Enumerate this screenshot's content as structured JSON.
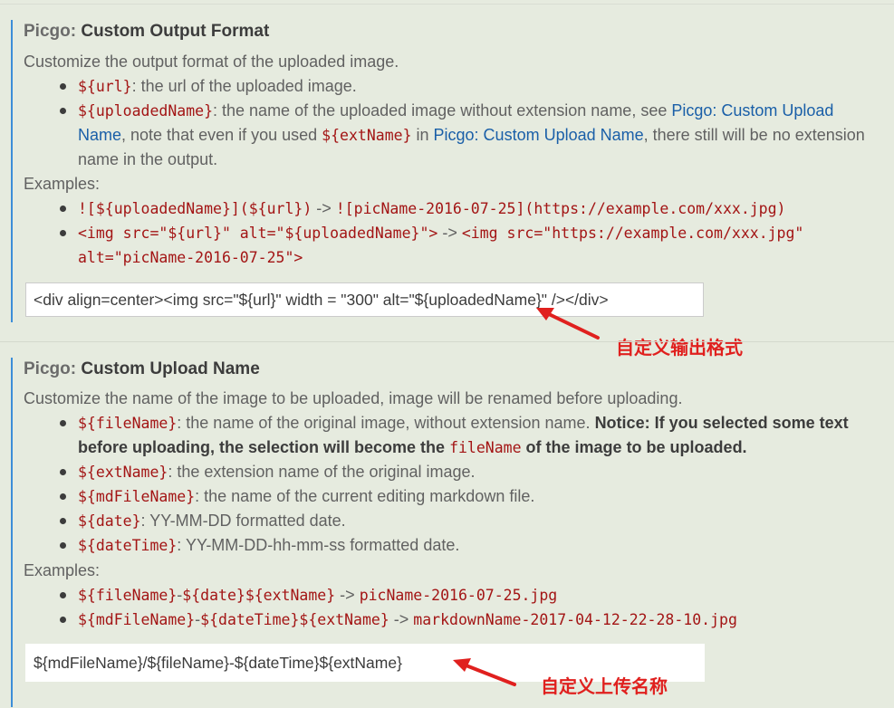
{
  "colors": {
    "accent": "#3d8ed8",
    "code": "#a31515",
    "link": "#1a5fa8",
    "annotation": "#e0201e",
    "background": "#e6ebdf"
  },
  "output_format": {
    "category": "Picgo: ",
    "title": "Custom Output Format",
    "description": "Customize the output format of the uploaded image.",
    "bullets": [
      {
        "code": "${url}",
        "text": ": the url of the uploaded image."
      },
      {
        "code": "${uploadedName}",
        "text1": ": the name of the uploaded image without extension name, see ",
        "link1": "Picgo: Custom Upload Name",
        "text2": ", note that even if you used ",
        "code2": "${extName}",
        "text3": " in ",
        "link2": "Picgo: Custom Upload Name",
        "text4": ", there still will be no extension name in the output."
      }
    ],
    "examples_label": "Examples:",
    "examples": [
      {
        "code": "![${uploadedName}](${url})",
        "arrow": " -> ",
        "result": "![picName-2016-07-25](https://example.com/xxx.jpg)"
      },
      {
        "code": "<img src=\"${url}\" alt=\"${uploadedName}\">",
        "arrow": " -> ",
        "result": "<img src=\"https://example.com/xxx.jpg\" alt=\"picName-2016-07-25\">"
      }
    ],
    "input_value": "<div align=center><img src=\"${url}\"  width = \"300\" alt=\"${uploadedName}\" /></div>",
    "annotation": "自定义输出格式"
  },
  "upload_name": {
    "category": "Picgo: ",
    "title": "Custom Upload Name",
    "description": "Customize the name of the image to be uploaded, image will be renamed before uploading.",
    "bullets": [
      {
        "code": "${fileName}",
        "text": ": the name of the original image, without extension name. ",
        "bold1": "Notice: If you selected some text before uploading, the selection will become the ",
        "bold_code": "fileName",
        "bold2": " of the image to be uploaded."
      },
      {
        "code": "${extName}",
        "text": ": the extension name of the original image."
      },
      {
        "code": "${mdFileName}",
        "text": ": the name of the current editing markdown file."
      },
      {
        "code": "${date}",
        "text": ": YY-MM-DD formatted date."
      },
      {
        "code": "${dateTime}",
        "text": ": YY-MM-DD-hh-mm-ss formatted date."
      }
    ],
    "examples_label": "Examples:",
    "examples": [
      {
        "code1": "${fileName}",
        "sep": "-",
        "code2": "${date}${extName}",
        "arrow": " -> ",
        "result": "picName-2016-07-25.jpg"
      },
      {
        "code1": "${mdFileName}",
        "sep": "-",
        "code2": "${dateTime}${extName}",
        "arrow": " -> ",
        "result": "markdownName-2017-04-12-22-28-10.jpg"
      }
    ],
    "input_value": "${mdFileName}/${fileName}-${dateTime}${extName}",
    "annotation": "自定义上传名称"
  }
}
